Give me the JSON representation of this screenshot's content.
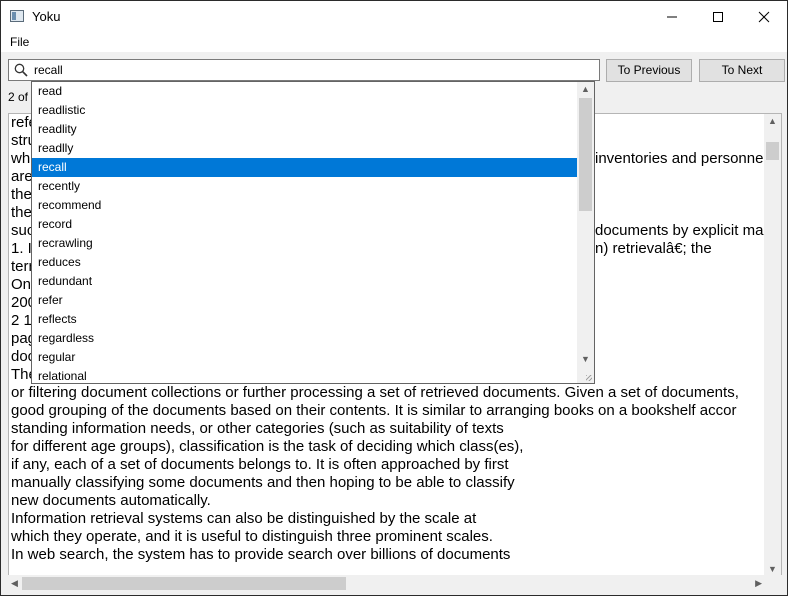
{
  "window": {
    "title": "Yoku"
  },
  "menu": {
    "file": "File"
  },
  "search": {
    "value": "recall"
  },
  "buttons": {
    "previous": "To Previous",
    "next": "To Next"
  },
  "status": {
    "match_count": "2 of"
  },
  "document_lines": [
    "refe",
    "stru",
    "whi",
    "are",
    "the",
    "the",
    "suc",
    "1. I",
    "terr",
    "On",
    "200",
    "2 1",
    "pag",
    "doc",
    "The",
    "or filtering document collections or further processing a set of retrieved documents. Given a set of documents,",
    "good grouping of the documents based on their contents. It is similar to arranging books on a bookshelf accor",
    "standing information needs, or other categories (such as suitability of texts",
    "for different age groups), classification is the task of deciding which class(es),",
    "if any, each of a set of documents belongs to. It is often approached by first",
    "manually classifying some documents and then hoping to be able to classify",
    "new documents automatically.",
    "Information retrieval systems can also be distinguished by the scale at",
    "which they operate, and it is useful to distinguish three prominent scales.",
    "In web search, the system has to provide search over billions of documents"
  ],
  "document_fragments": [
    {
      "row": 2,
      "text": "inventories and personne"
    },
    {
      "row": 6,
      "text": "documents by explicit ma"
    },
    {
      "row": 7,
      "text": "n) retrievalâ€; the"
    }
  ],
  "autocomplete": {
    "items": [
      "read",
      "readlistic",
      "readlity",
      "readlly",
      "recall",
      "recently",
      "recommend",
      "record",
      "recrawling",
      "reduces",
      "redundant",
      "refer",
      "reflects",
      "regardless",
      "regular",
      "relational"
    ],
    "selected_index": 4
  }
}
